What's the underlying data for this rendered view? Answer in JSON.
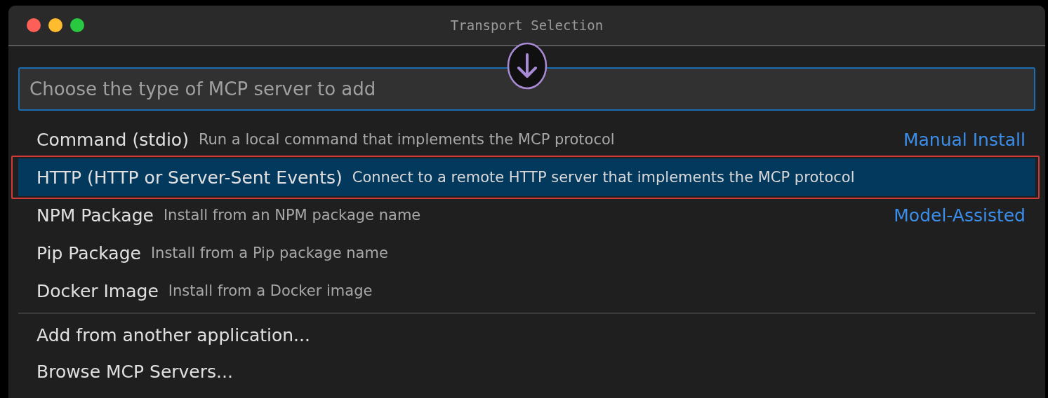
{
  "window": {
    "title": "Transport Selection"
  },
  "search": {
    "placeholder": "Choose the type of MCP server to add"
  },
  "groups": [
    {
      "items": [
        {
          "label": "Command (stdio)",
          "description": "Run a local command that implements the MCP protocol",
          "tag": "Manual Install",
          "selected": false,
          "highlighted": false
        },
        {
          "label": "HTTP (HTTP or Server-Sent Events)",
          "description": "Connect to a remote HTTP server that implements the MCP protocol",
          "selected": true,
          "highlighted": true
        },
        {
          "label": "NPM Package",
          "description": "Install from an NPM package name",
          "tag": "Model-Assisted",
          "selected": false,
          "highlighted": false
        },
        {
          "label": "Pip Package",
          "description": "Install from a Pip package name",
          "selected": false,
          "highlighted": false
        },
        {
          "label": "Docker Image",
          "description": "Install from a Docker image",
          "selected": false,
          "highlighted": false
        }
      ]
    },
    {
      "items": [
        {
          "label": "Add from another application...",
          "selected": false,
          "highlighted": false
        },
        {
          "label": "Browse MCP Servers...",
          "selected": false,
          "highlighted": false
        }
      ]
    }
  ]
}
